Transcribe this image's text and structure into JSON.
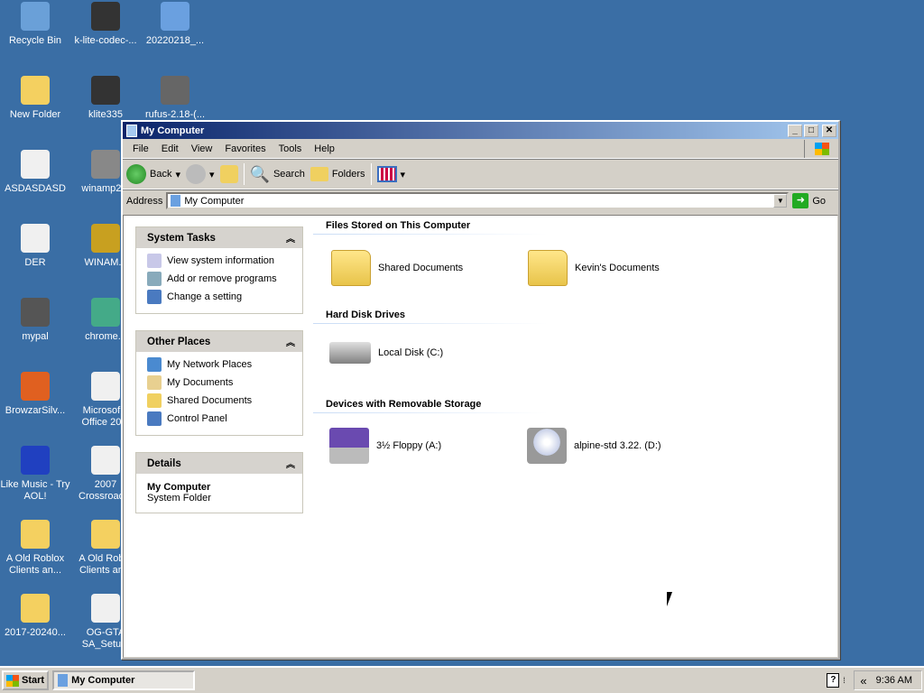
{
  "desktop": {
    "icons": [
      {
        "label": "Recycle Bin",
        "icon": "recycle-bin-icon",
        "color": "#6aa0d8"
      },
      {
        "label": "k-lite-codec-...",
        "icon": "media-player-icon",
        "color": "#333"
      },
      {
        "label": "20220218_...",
        "icon": "installer-icon",
        "color": "#6aa0e0"
      },
      {
        "label": "New Folder",
        "icon": "folder-icon",
        "color": "#f4d060"
      },
      {
        "label": "klite335",
        "icon": "media-player-icon",
        "color": "#333"
      },
      {
        "label": "rufus-2.18-(...",
        "icon": "usb-drive-icon",
        "color": "#666"
      },
      {
        "label": "ASDASDASD",
        "icon": "document-icon",
        "color": "#f0f0f0"
      },
      {
        "label": "winamp2...",
        "icon": "winamp-icon",
        "color": "#888"
      },
      {
        "label": "DER",
        "icon": "document-icon",
        "color": "#f0f0f0"
      },
      {
        "label": "WINAM...",
        "icon": "winamp-icon",
        "color": "#c8a020"
      },
      {
        "label": "mypal",
        "icon": "mypal-icon",
        "color": "#555"
      },
      {
        "label": "chrome...",
        "icon": "chrome-icon",
        "color": "#4a8"
      },
      {
        "label": "BrowzarSilv...",
        "icon": "browzar-icon",
        "color": "#e06020"
      },
      {
        "label": "Microsof... Office 20...",
        "icon": "setup-icon",
        "color": "#f0f0f0"
      },
      {
        "label": "Like Music - Try AOL!",
        "icon": "music-icon",
        "color": "#2040c0"
      },
      {
        "label": "2007 Crossroad...",
        "icon": "document-icon",
        "color": "#f0f0f0"
      },
      {
        "label": "A Old Roblox Clients an...",
        "icon": "zip-folder-icon",
        "color": "#f4d060"
      },
      {
        "label": "A Old Rob... Clients an...",
        "icon": "folder-icon",
        "color": "#f4d060"
      },
      {
        "label": "2017-20240...",
        "icon": "zip-folder-icon",
        "color": "#f4d060"
      },
      {
        "label": "OG-GTA SA_Setu...",
        "icon": "setup-icon",
        "color": "#f0f0f0"
      }
    ]
  },
  "window": {
    "title": "My Computer",
    "minimize": "_",
    "maximize": "□",
    "close": "✕"
  },
  "menu": [
    "File",
    "Edit",
    "View",
    "Favorites",
    "Tools",
    "Help"
  ],
  "toolbar": {
    "back": "Back",
    "search": "Search",
    "folders": "Folders"
  },
  "address": {
    "label": "Address",
    "value": "My Computer",
    "go": "Go"
  },
  "panes": [
    {
      "title": "System Tasks",
      "items": [
        "View system information",
        "Add or remove programs",
        "Change a setting"
      ]
    },
    {
      "title": "Other Places",
      "items": [
        "My Network Places",
        "My Documents",
        "Shared Documents",
        "Control Panel"
      ]
    },
    {
      "title": "Details",
      "name": "My Computer",
      "desc": "System Folder"
    }
  ],
  "groups": [
    {
      "title": "Files Stored on This Computer",
      "items": [
        "Shared Documents",
        "Kevin's Documents"
      ]
    },
    {
      "title": "Hard Disk Drives",
      "items": [
        "Local Disk (C:)"
      ]
    },
    {
      "title": "Devices with Removable Storage",
      "items": [
        "3½ Floppy (A:)",
        "alpine-std 3.22. (D:)"
      ]
    }
  ],
  "taskbar": {
    "start": "Start",
    "task": "My Computer",
    "clock": "9:36 AM",
    "chevron": "«"
  },
  "colors": {
    "desktop": "#3a6ea5",
    "titlebar": "#0a246a"
  }
}
